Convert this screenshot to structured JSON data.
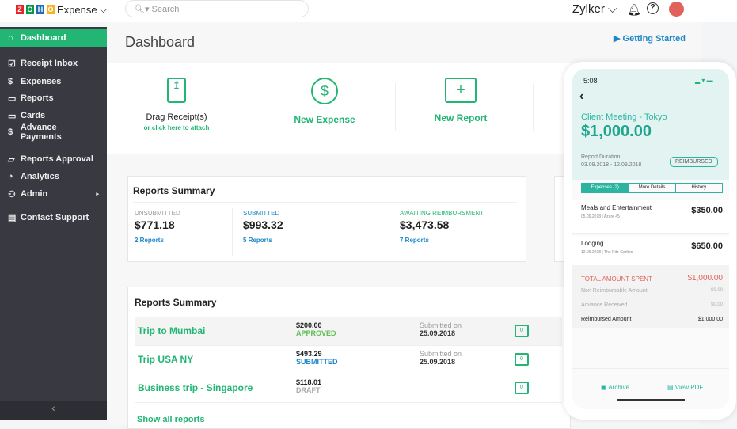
{
  "app": {
    "logo": "ZOHO",
    "name": "Expense",
    "search_placeholder": "Search",
    "user": "Zylker"
  },
  "colors": {
    "accent": "#22b573",
    "sidebar": "#393a41",
    "link": "#1b87c9",
    "total": "#e0625a"
  },
  "sidebar": {
    "items": [
      {
        "label": "Dashboard",
        "icon": "home-icon"
      },
      {
        "label": "Receipt Inbox",
        "icon": "inbox-icon"
      },
      {
        "label": "Expenses",
        "icon": "dollar-icon"
      },
      {
        "label": "Reports",
        "icon": "folder-icon"
      },
      {
        "label": "Cards",
        "icon": "card-icon"
      },
      {
        "label": "Advance Payments",
        "icon": "dollar-icon"
      },
      {
        "label": "Reports Approval",
        "icon": "approval-icon"
      },
      {
        "label": "Analytics",
        "icon": "pie-icon"
      },
      {
        "label": "Admin",
        "icon": "admin-icon"
      },
      {
        "label": "Contact Support",
        "icon": "chat-icon"
      }
    ]
  },
  "page": {
    "title": "Dashboard",
    "getting_started": "Getting Started"
  },
  "actions": {
    "drag": "Drag Receipt(s)",
    "attach": "or click here to attach",
    "new_expense": "New Expense",
    "new_report": "New Report"
  },
  "summary": {
    "title": "Reports Summary",
    "cols": [
      {
        "label": "UNSUBMITTED",
        "amount": "$771.18",
        "link": "2 Reports",
        "color": "#999"
      },
      {
        "label": "SUBMITTED",
        "amount": "$993.32",
        "link": "5 Reports",
        "color": "#1b87c9"
      },
      {
        "label": "AWAITING REIMBURSMENT",
        "amount": "$3,473.58",
        "link": "7 Reports",
        "color": "#22b573"
      }
    ]
  },
  "reports": {
    "title": "Reports Summary",
    "rows": [
      {
        "name": "Trip to Mumbai",
        "amount": "$200.00",
        "status": "APPROVED",
        "status_color": "#5cbf4f",
        "submitted": "Submitted on",
        "date": "25.09.2018",
        "comments": "0"
      },
      {
        "name": "Trip USA NY",
        "amount": "$493.29",
        "status": "SUBMITTED",
        "status_color": "#1b87c9",
        "submitted": "Submitted on",
        "date": "25.09.2018",
        "comments": "0"
      },
      {
        "name": "Business trip - Singapore",
        "amount": "$118.01",
        "status": "DRAFT",
        "status_color": "#aaa",
        "submitted": "",
        "date": "",
        "comments": "0"
      }
    ],
    "show_all": "Show all reports"
  },
  "phone": {
    "time": "5:08",
    "title": "Client Meeting - Tokyo",
    "amount": "$1,000.00",
    "duration_label": "Report Duration",
    "duration": "03.09.2018 - 12.09.2018",
    "badge": "REIMBURSED",
    "tabs": [
      "Expenses (2)",
      "More Details",
      "History"
    ],
    "expenses": [
      {
        "name": "Meals and Entertainment",
        "meta": "05.09.2018 | Azure 45",
        "amount": "$350.00"
      },
      {
        "name": "Lodging",
        "meta": "12.09.2018 | The Ritz-Carlton",
        "amount": "$650.00"
      }
    ],
    "totals": [
      {
        "label": "TOTAL AMOUNT SPENT",
        "value": "$1,000.00"
      },
      {
        "label": "Non Reimbursable Amount",
        "value": "$0.00"
      },
      {
        "label": "Advance Received",
        "value": "$0.00"
      },
      {
        "label": "Reimbursed Amount",
        "value": "$1,000.00"
      }
    ],
    "archive": "Archive",
    "view_pdf": "View PDF"
  }
}
